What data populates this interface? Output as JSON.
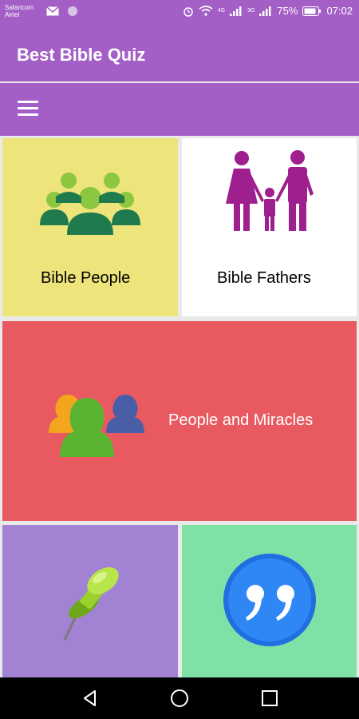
{
  "status_bar": {
    "carrier1": "Safaricom",
    "carrier2": "Airtel",
    "signal1": "4G",
    "signal2": "3G",
    "battery": "75%",
    "time": "07:02"
  },
  "app": {
    "title": "Best Bible Quiz"
  },
  "tiles": [
    {
      "label": "Bible People",
      "color": "#eee47c"
    },
    {
      "label": "Bible Fathers",
      "color": "#ffffff"
    },
    {
      "label": "People and Miracles",
      "color": "#e85a5f"
    },
    {
      "label": "",
      "color": "#a282d2"
    },
    {
      "label": "",
      "color": "#7fe1a6"
    }
  ],
  "icons": {
    "menu": "hamburger-menu-icon",
    "tile1": "group-people-icon",
    "tile2": "family-icon",
    "tile3": "users-icon",
    "tile4": "pushpin-icon",
    "tile5": "quote-icon"
  },
  "colors": {
    "primary": "#a35fc6"
  }
}
